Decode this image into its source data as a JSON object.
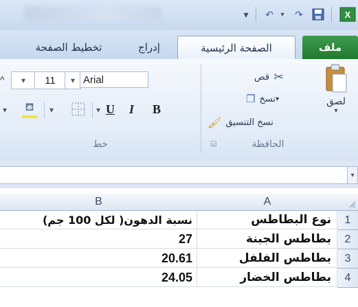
{
  "tabs": {
    "file": "ملف",
    "home": "الصفحة الرئيسية",
    "insert": "إدراج",
    "page_layout": "تخطيط الصفحة"
  },
  "ribbon": {
    "clipboard": {
      "label": "الحافظة",
      "paste": "لصق",
      "cut": "قص",
      "copy": "نسخ",
      "format_painter": "نسخ التنسيق"
    },
    "font": {
      "label": "خط",
      "font_name": "Arial",
      "font_size": "11",
      "bold": "B",
      "italic": "I",
      "underline": "U"
    }
  },
  "columns": [
    "A",
    "B"
  ],
  "rows": [
    {
      "num": "1",
      "a": "نوع البطاطس",
      "b": "نسبة الدهون( لكل 100 جم)"
    },
    {
      "num": "2",
      "a": "بطاطس الجبنة",
      "b": "27"
    },
    {
      "num": "3",
      "a": "بطاطس الفلفل",
      "b": "20.61"
    },
    {
      "num": "4",
      "a": "بطاطس الخضار",
      "b": "24.05"
    }
  ],
  "colors": {
    "file_tab": "#1f7a2d",
    "ribbon_bg": "#e3ecf8",
    "header_bg": "#dde6f2"
  }
}
